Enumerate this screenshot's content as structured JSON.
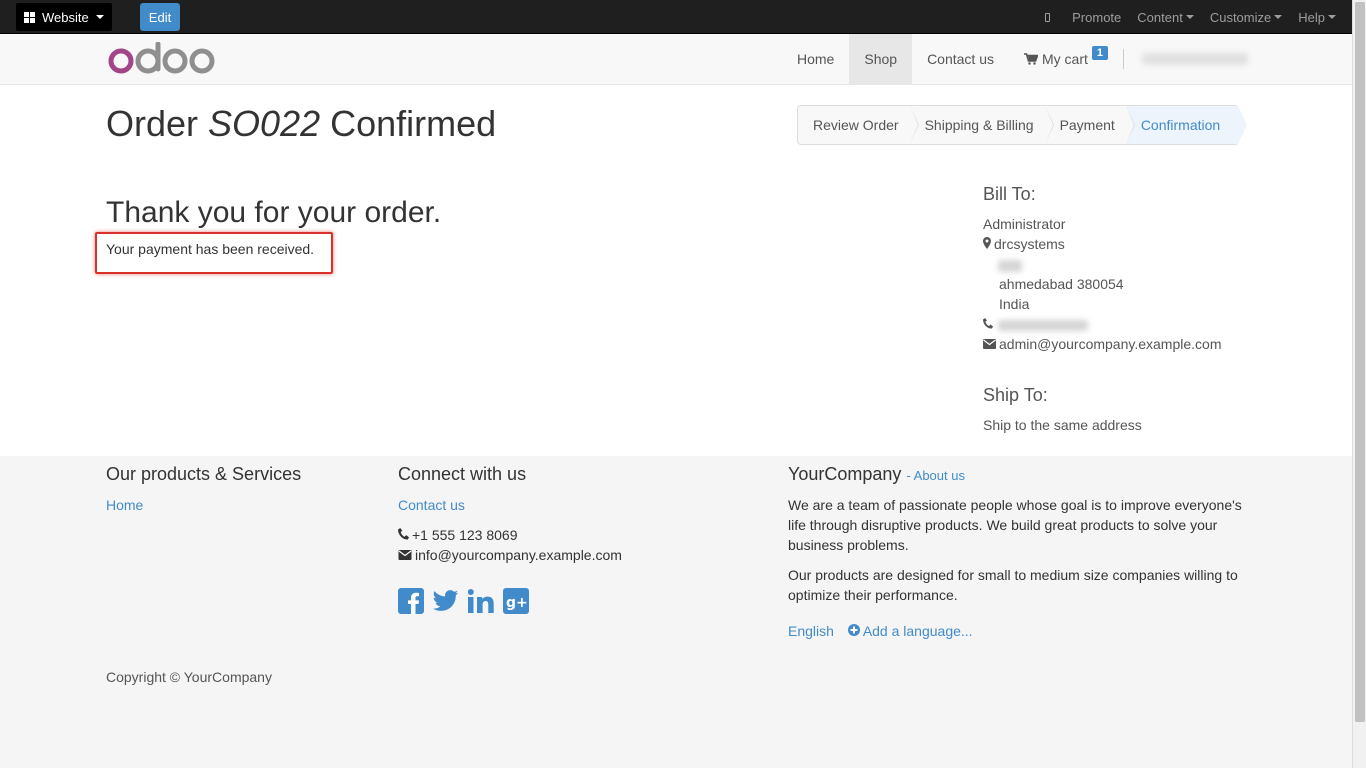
{
  "adminbar": {
    "website_label": "Website",
    "edit_label": "Edit",
    "menu": [
      "Promote",
      "Content",
      "Customize",
      "Help"
    ]
  },
  "header": {
    "logo_text": "odoo",
    "nav": {
      "home": "Home",
      "shop": "Shop",
      "contact": "Contact us",
      "cart": "My cart",
      "cart_count": "1"
    }
  },
  "main": {
    "title_prefix": "Order ",
    "order_ref": "SO022",
    "title_suffix": " Confirmed",
    "steps": [
      "Review Order",
      "Shipping & Billing",
      "Payment",
      "Confirmation"
    ],
    "active_step": "Confirmation",
    "thanks": "Thank you for your order.",
    "payment_msg": "Your payment has been received.",
    "bill_to": {
      "heading": "Bill To:",
      "name": "Administrator",
      "company": "drcsystems",
      "city_line": "ahmedabad 380054",
      "country": "India",
      "email": "admin@yourcompany.example.com"
    },
    "ship_to": {
      "heading": "Ship To:",
      "text": "Ship to the same address"
    }
  },
  "footer": {
    "col1": {
      "heading": "Our products & Services",
      "link": "Home"
    },
    "col2": {
      "heading": "Connect with us",
      "link": "Contact us",
      "phone": "+1 555 123 8069",
      "email": "info@yourcompany.example.com"
    },
    "col3": {
      "heading": "YourCompany",
      "about": "- About us",
      "p1": "We are a team of passionate people whose goal is to improve everyone's life through disruptive products. We build great products to solve your business problems.",
      "p2": "Our products are designed for small to medium size companies willing to optimize their performance.",
      "lang": "English",
      "add_lang": "Add a language..."
    },
    "copyright": "Copyright © YourCompany"
  },
  "colors": {
    "accent": "#428bca",
    "highlight_box": "#d9322c",
    "logo_purple": "#a24689",
    "logo_gray": "#8f8f8f"
  }
}
